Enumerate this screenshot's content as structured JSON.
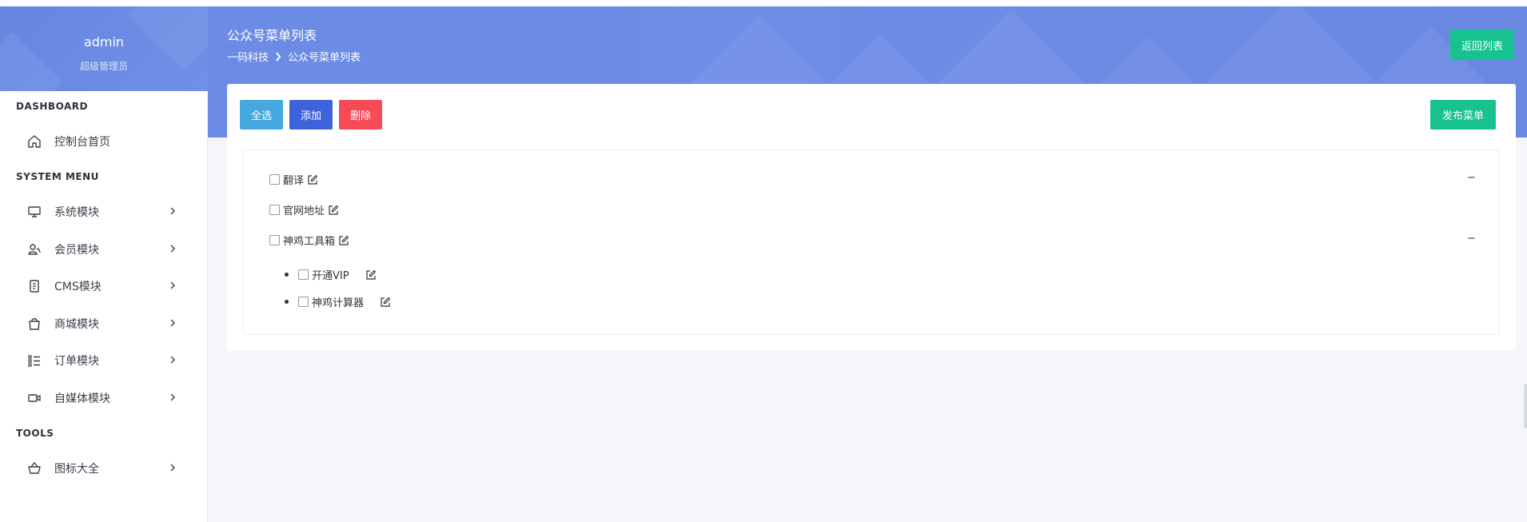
{
  "profile": {
    "name": "admin",
    "role": "超级管理员"
  },
  "header": {
    "title": "公众号菜单列表",
    "breadcrumb": [
      "一码科技",
      "公众号菜单列表"
    ],
    "back_label": "返回列表"
  },
  "nav": {
    "sections": [
      {
        "title": "DASHBOARD",
        "items": [
          {
            "label": "控制台首页",
            "icon": "home-icon",
            "has_children": false
          }
        ]
      },
      {
        "title": "SYSTEM MENU",
        "items": [
          {
            "label": "系统模块",
            "icon": "monitor-icon",
            "has_children": true
          },
          {
            "label": "会员模块",
            "icon": "users-icon",
            "has_children": true
          },
          {
            "label": "CMS模块",
            "icon": "document-icon",
            "has_children": true
          },
          {
            "label": "商城模块",
            "icon": "shopping-bag-icon",
            "has_children": true
          },
          {
            "label": "订单模块",
            "icon": "list-icon",
            "has_children": true
          },
          {
            "label": "自媒体模块",
            "icon": "video-icon",
            "has_children": true
          }
        ]
      },
      {
        "title": "TOOLS",
        "items": [
          {
            "label": "图标大全",
            "icon": "basket-icon",
            "has_children": true
          }
        ]
      }
    ]
  },
  "toolbar": {
    "select_all": "全选",
    "add": "添加",
    "delete": "删除",
    "publish": "发布菜单"
  },
  "menu_tree": [
    {
      "label": "翻译",
      "collapse": "−",
      "children": []
    },
    {
      "label": "官网地址",
      "collapse": "",
      "children": []
    },
    {
      "label": "神鸡工具箱",
      "collapse": "−",
      "children": [
        {
          "label": "开通VIP"
        },
        {
          "label": "神鸡计算器"
        }
      ]
    }
  ],
  "colors": {
    "header": "#6b8ae4",
    "green": "#17c28f",
    "blue_light": "#45a6e0",
    "blue": "#3d63db",
    "red": "#f64a57"
  }
}
